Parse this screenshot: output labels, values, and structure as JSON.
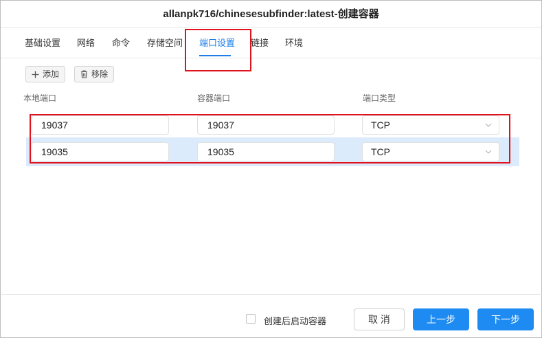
{
  "dialog": {
    "title": "allanpk716/chinesesubfinder:latest-创建容器"
  },
  "tabs": [
    {
      "label": "基础设置",
      "active": false
    },
    {
      "label": "网络",
      "active": false
    },
    {
      "label": "命令",
      "active": false
    },
    {
      "label": "存储空间",
      "active": false
    },
    {
      "label": "端口设置",
      "active": true
    },
    {
      "label": "链接",
      "active": false
    },
    {
      "label": "环境",
      "active": false
    }
  ],
  "toolbar": {
    "add_label": "添加",
    "add_icon": "plus-icon",
    "remove_label": "移除",
    "remove_icon": "trash-icon"
  },
  "table": {
    "headers": [
      "本地端口",
      "容器端口",
      "端口类型"
    ],
    "rows": [
      {
        "local_port": "19037",
        "container_port": "19037",
        "type": "TCP",
        "selected": false
      },
      {
        "local_port": "19035",
        "container_port": "19035",
        "type": "TCP",
        "selected": true
      }
    ]
  },
  "footer": {
    "auto_start_label": "创建后启动容器",
    "auto_start_checked": false,
    "cancel_label": "取 消",
    "prev_label": "上一步",
    "next_label": "下一步"
  },
  "colors": {
    "accent": "#1d8bf1",
    "selected_row": "#dcebfb",
    "highlight_box": "#e0121d"
  }
}
